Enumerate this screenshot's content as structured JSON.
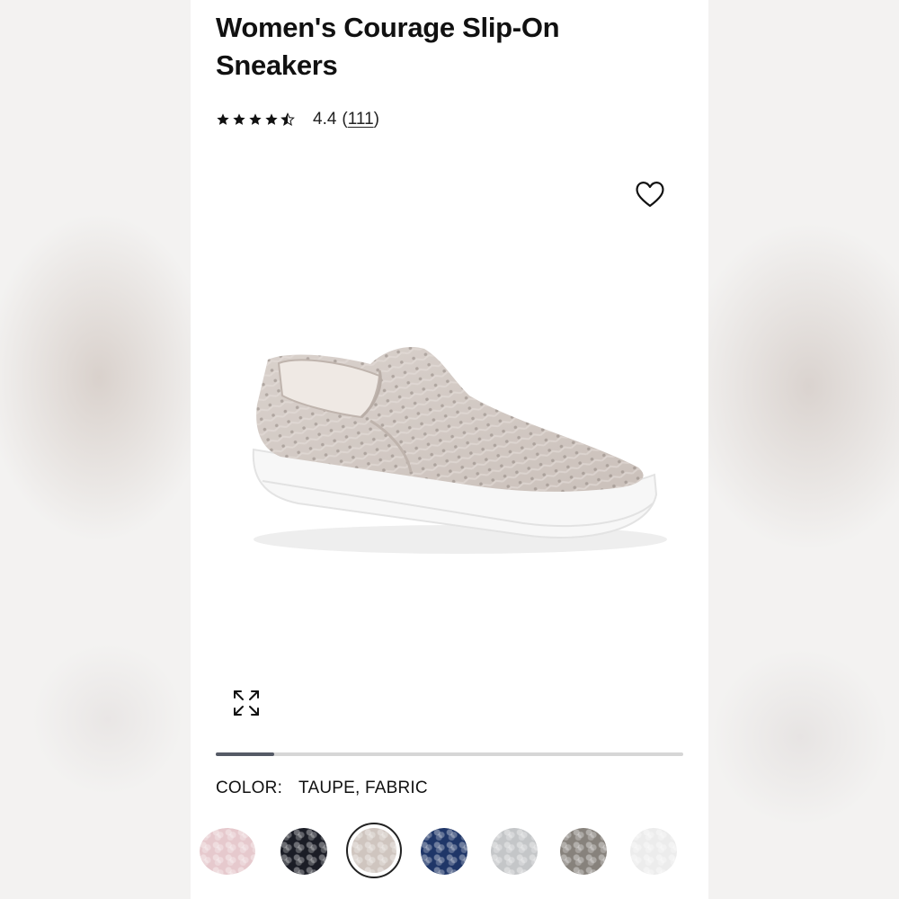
{
  "product": {
    "title": "Women's Courage Slip-On Sneakers",
    "rating_value": "4.4",
    "rating_count": "111",
    "stars": 4.5
  },
  "icons": {
    "favorite": "heart-outline-icon",
    "expand": "expand-arrows-icon",
    "star": "star-icon"
  },
  "gallery": {
    "progress": 0.125
  },
  "color": {
    "label": "COLOR:",
    "selected": "TAUPE, FABRIC",
    "swatches": [
      {
        "name": "blush",
        "hex": "#e6c9cd"
      },
      {
        "name": "black",
        "hex": "#1b1d26"
      },
      {
        "name": "taupe",
        "hex": "#cfc5bf"
      },
      {
        "name": "navy",
        "hex": "#1f3668"
      },
      {
        "name": "light-grey",
        "hex": "#c4c6c8"
      },
      {
        "name": "grey",
        "hex": "#87827c"
      },
      {
        "name": "white",
        "hex": "#ececec"
      }
    ]
  }
}
